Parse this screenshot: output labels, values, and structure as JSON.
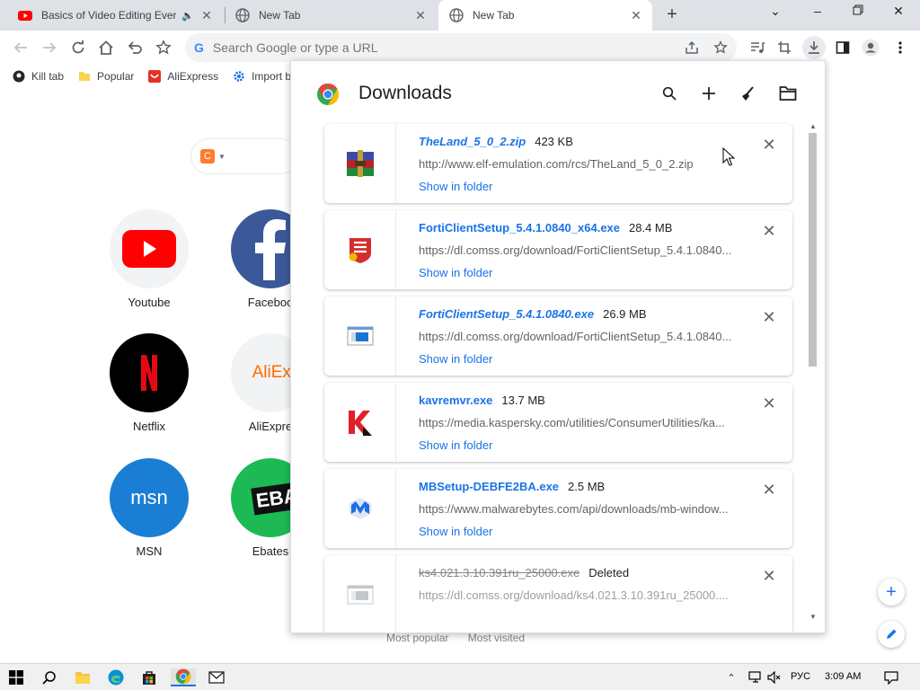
{
  "tabs": [
    {
      "title": "Basics of Video Editing Everyon",
      "favicon": "youtube-icon",
      "audio": true
    },
    {
      "title": "New Tab",
      "favicon": "globe-icon"
    },
    {
      "title": "New Tab",
      "favicon": "globe-icon",
      "active": true
    }
  ],
  "omnibox": {
    "placeholder": "Search Google or type a URL"
  },
  "bookmarks": [
    {
      "label": "Kill tab",
      "icon": "github-icon"
    },
    {
      "label": "Popular",
      "icon": "folder-icon"
    },
    {
      "label": "AliExpress",
      "icon": "aliexpress-icon"
    },
    {
      "label": "Import bookm",
      "icon": "gear-icon"
    }
  ],
  "shortcuts": [
    {
      "label": "Youtube"
    },
    {
      "label": "Faceboo"
    },
    {
      "label": "Netflix"
    },
    {
      "label": "AliExpre"
    },
    {
      "label": "MSN"
    },
    {
      "label": "Ebates"
    }
  ],
  "shortcut_logos": {
    "aliexpress": "AliExpre",
    "msn": "msn",
    "ebates": "EBAT"
  },
  "ntp_footer": {
    "most_popular": "Most popular",
    "most_visited": "Most visited"
  },
  "downloads": {
    "title": "Downloads",
    "items": [
      {
        "name": "TheLand_5_0_2.zip",
        "size": "423 KB",
        "url": "http://www.elf-emulation.com/rcs/TheLand_5_0_2.zip",
        "action": "Show in folder",
        "icon": "winrar-icon",
        "italic": true
      },
      {
        "name": "FortiClientSetup_5.4.1.0840_x64.exe",
        "size": "28.4 MB",
        "url": "https://dl.comss.org/download/FortiClientSetup_5.4.1.0840...",
        "action": "Show in folder",
        "icon": "forticlient-icon"
      },
      {
        "name": "FortiClientSetup_5.4.1.0840.exe",
        "size": "26.9 MB",
        "url": "https://dl.comss.org/download/FortiClientSetup_5.4.1.0840...",
        "action": "Show in folder",
        "icon": "exe-icon",
        "italic": true
      },
      {
        "name": "kavremvr.exe",
        "size": "13.7 MB",
        "url": "https://media.kaspersky.com/utilities/ConsumerUtilities/ka...",
        "action": "Show in folder",
        "icon": "kaspersky-icon"
      },
      {
        "name": "MBSetup-DEBFE2BA.exe",
        "size": "2.5 MB",
        "url": "https://www.malwarebytes.com/api/downloads/mb-window...",
        "action": "Show in folder",
        "icon": "malwarebytes-icon"
      },
      {
        "name": "ks4.021.3.10.391ru_25000.exe",
        "size": "Deleted",
        "url": "https://dl.comss.org/download/ks4.021.3.10.391ru_25000....",
        "action": "",
        "icon": "exe-icon",
        "deleted": true
      }
    ]
  },
  "taskbar": {
    "lang": "РУС",
    "time": "3:09 AM"
  }
}
